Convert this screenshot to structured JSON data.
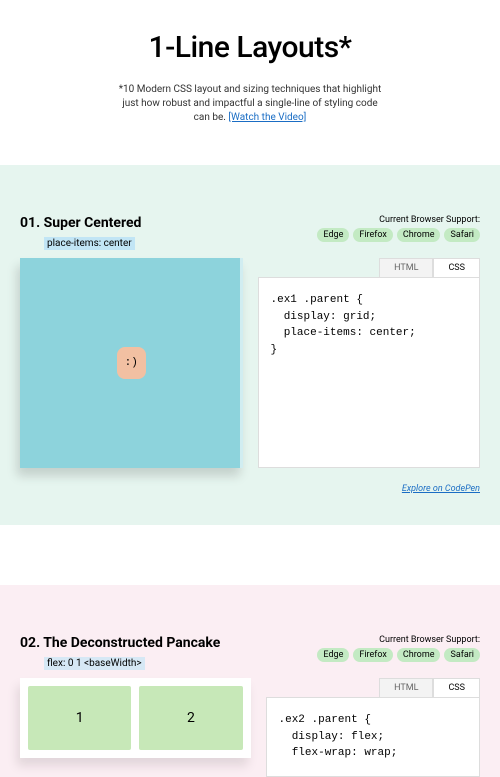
{
  "hero": {
    "title": "1-Line Layouts*",
    "desc_a": "*10 Modern CSS layout and sizing techniques that highlight just how robust and impactful a single-line of styling code can be. ",
    "link": "[Watch the Video]"
  },
  "ex1": {
    "title": "01. Super Centered",
    "sub": "place-items: center",
    "support_label": "Current Browser Support:",
    "badges": [
      "Edge",
      "Firefox",
      "Chrome",
      "Safari"
    ],
    "tab_html": "HTML",
    "tab_css": "CSS",
    "code": ".ex1 .parent {\n  display: grid;\n  place-items: center;\n}",
    "face": ":)",
    "explore": "Explore on CodePen"
  },
  "ex2": {
    "title": "02. The Deconstructed Pancake",
    "sub": "flex: 0 1 <baseWidth>",
    "support_label": "Current Browser Support:",
    "badges": [
      "Edge",
      "Firefox",
      "Chrome",
      "Safari"
    ],
    "tab_html": "HTML",
    "tab_css": "CSS",
    "code": ".ex2 .parent {\n  display: flex;\n  flex-wrap: wrap;",
    "cards": [
      "1",
      "2"
    ]
  }
}
